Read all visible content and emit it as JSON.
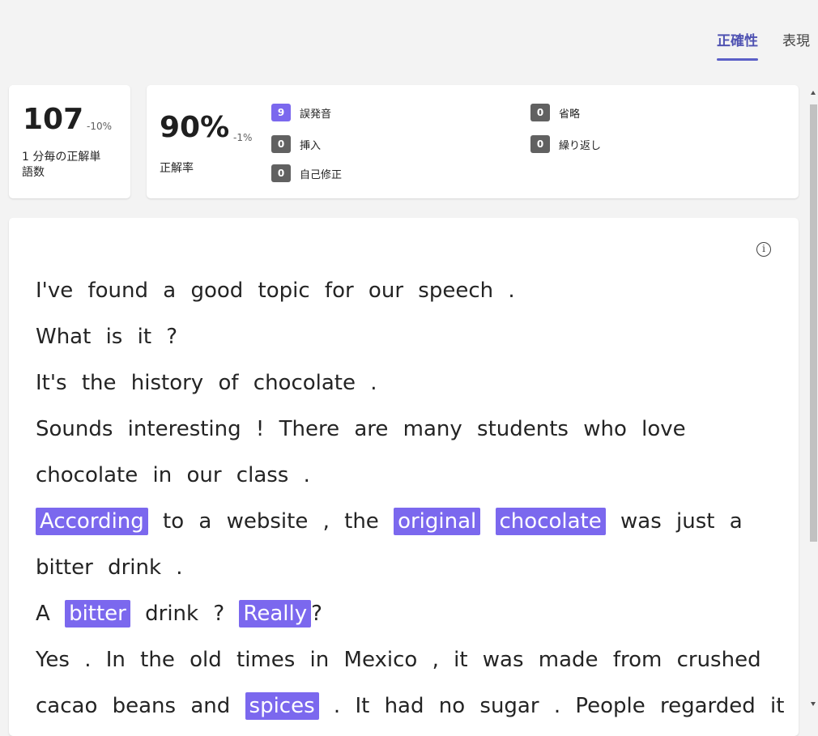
{
  "tabs": [
    {
      "label": "正確性",
      "active": true
    },
    {
      "label": "表現",
      "active": false
    }
  ],
  "wpm": {
    "value": "107",
    "delta": "-10%",
    "label_line1": "1 分毎の正解単",
    "label_line2": "語数"
  },
  "accuracy": {
    "value": "90%",
    "delta": "-1%",
    "label": "正解率"
  },
  "error_counts": [
    {
      "count": "9",
      "label": "誤発音",
      "color": "#7b68ee"
    },
    {
      "count": "0",
      "label": "挿入",
      "color": "#616161"
    },
    {
      "count": "0",
      "label": "自己修正",
      "color": "#616161"
    },
    {
      "count": "0",
      "label": "省略",
      "color": "#616161"
    },
    {
      "count": "0",
      "label": "繰り返し",
      "color": "#616161"
    }
  ],
  "info_icon": "info-icon",
  "highlight_color": "#7b68ee",
  "passage": [
    [
      {
        "t": "I've found a good topic for our speech ."
      }
    ],
    [
      {
        "t": "What is it ?"
      }
    ],
    [
      {
        "t": "It's the history of chocolate ."
      }
    ],
    [
      {
        "t": "Sounds interesting ! There are many students who love"
      }
    ],
    [
      {
        "t": "chocolate in our class ."
      }
    ],
    [
      {
        "t": "According",
        "hl": true
      },
      {
        "t": " to a website , the "
      },
      {
        "t": "original",
        "hl": true
      },
      {
        "t": " "
      },
      {
        "t": "chocolate",
        "hl": true
      },
      {
        "t": " was just a"
      }
    ],
    [
      {
        "t": "bitter drink ."
      }
    ],
    [
      {
        "t": "A "
      },
      {
        "t": "bitter",
        "hl": true
      },
      {
        "t": " drink ? "
      },
      {
        "t": "Really",
        "hl": true
      },
      {
        "t": "?"
      }
    ],
    [
      {
        "t": "Yes . In the old times in Mexico , it was made from crushed"
      }
    ],
    [
      {
        "t": "cacao beans and "
      },
      {
        "t": "spices",
        "hl": true
      },
      {
        "t": " . It had no sugar . People regarded it"
      }
    ]
  ]
}
